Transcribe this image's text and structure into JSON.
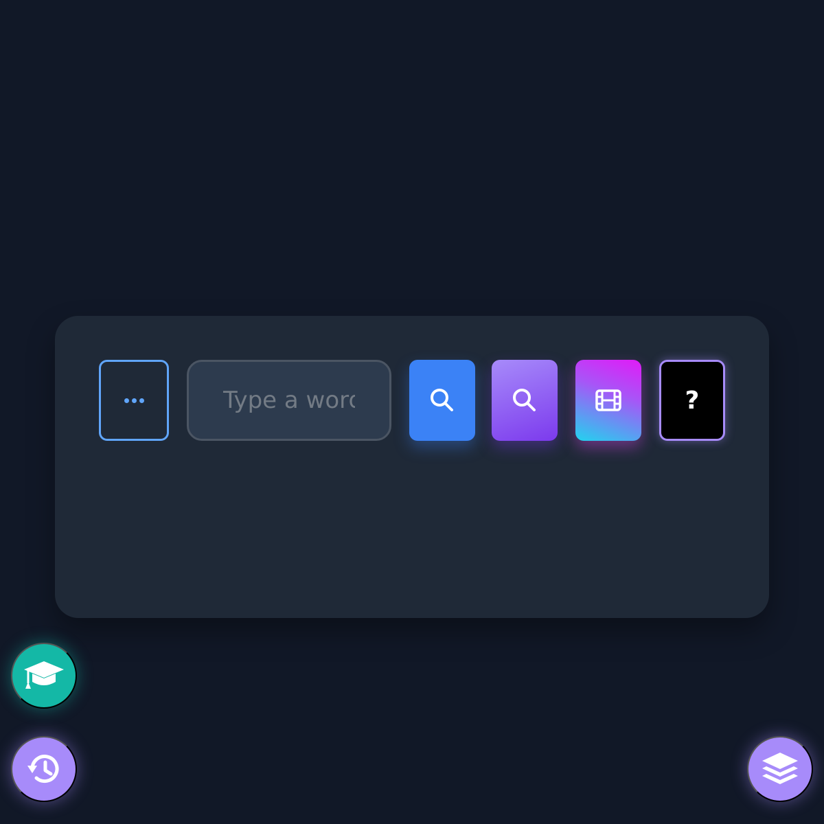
{
  "search_panel": {
    "more_button": {
      "icon": "ellipsis-icon"
    },
    "word_input": {
      "placeholder": "Type a word",
      "value": ""
    },
    "search_button": {
      "icon": "search-icon",
      "color": "#3b82f6"
    },
    "search_alt_button": {
      "icon": "search-icon",
      "color": "#7c3aed"
    },
    "video_button": {
      "icon": "film-icon"
    },
    "help_button": {
      "label": "?",
      "border_color": "#a78bfa"
    }
  },
  "floating_buttons": {
    "learn": {
      "icon": "graduation-cap-icon",
      "color": "#14b8a6"
    },
    "history": {
      "icon": "history-icon",
      "color": "#a78bfa"
    },
    "layers": {
      "icon": "layers-icon",
      "color": "#a78bfa"
    }
  }
}
